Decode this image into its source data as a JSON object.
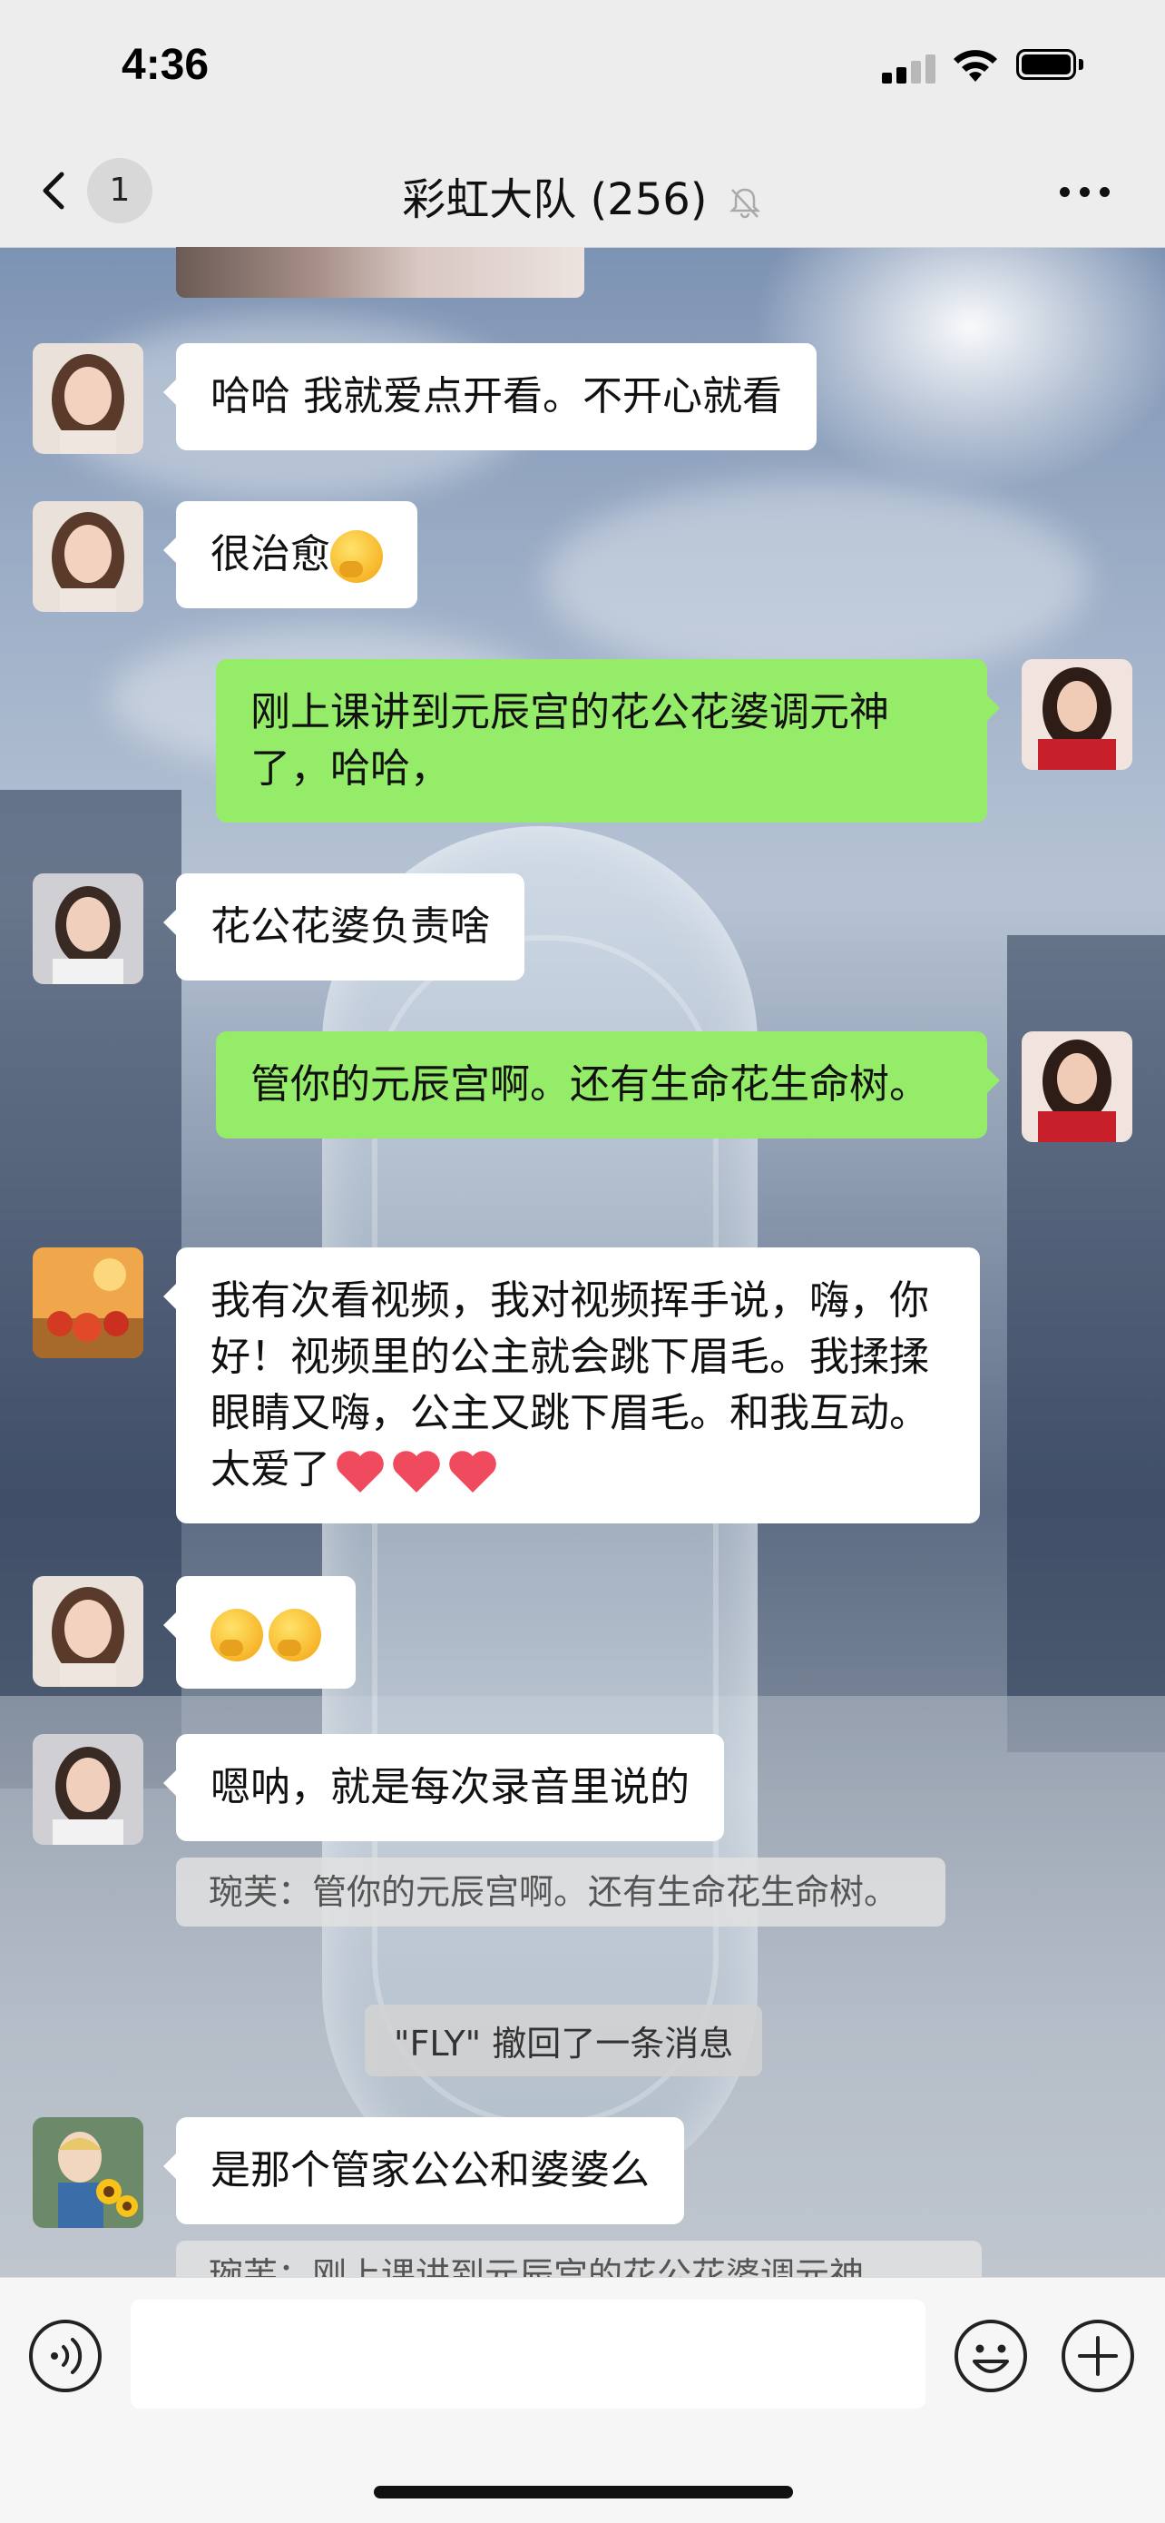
{
  "status_bar": {
    "time": "4:36"
  },
  "nav": {
    "unread_count": "1",
    "title": "彩虹大队 (256)"
  },
  "messages": [
    {
      "type": "in",
      "avatar": "avatar-girl-1",
      "text": "哈哈 我就爱点开看。不开心就看"
    },
    {
      "type": "in",
      "avatar": "avatar-girl-1",
      "text": "很治愈",
      "emoji": [
        "thinking-emoji"
      ]
    },
    {
      "type": "out",
      "avatar": "avatar-self",
      "text": "刚上课讲到元辰宫的花公花婆调元神了，哈哈，"
    },
    {
      "type": "in",
      "avatar": "avatar-woman-2",
      "text": "花公花婆负责啥"
    },
    {
      "type": "out",
      "avatar": "avatar-self",
      "text": "管你的元辰宫啊。还有生命花生命树。"
    },
    {
      "type": "in",
      "avatar": "avatar-apples",
      "text": "我有次看视频，我对视频挥手说，嗨，你好！视频里的公主就会跳下眉毛。我揉揉眼睛又嗨，公主又跳下眉毛。和我互动。太爱了",
      "emoji": [
        "heart",
        "heart",
        "heart"
      ]
    },
    {
      "type": "in",
      "avatar": "avatar-girl-1",
      "text": "",
      "emoji": [
        "thinking-emoji",
        "thinking-emoji"
      ]
    },
    {
      "type": "in",
      "avatar": "avatar-woman-2",
      "text": "嗯呐，就是每次录音里说的",
      "quote": "琬芙：管你的元辰宫啊。还有生命花生命树。"
    },
    {
      "type": "system",
      "text": "\"FLY\" 撤回了一条消息"
    },
    {
      "type": "in",
      "avatar": "avatar-child-sunflowers",
      "text": "是那个管家公公和婆婆么",
      "quote": "琬芙：刚上课讲到元辰宫的花公花婆调元神"
    }
  ],
  "input": {
    "value": "",
    "placeholder": ""
  },
  "colors": {
    "outgoing_bubble": "#95ec69",
    "incoming_bubble": "#ffffff",
    "bar_background": "#ededed"
  }
}
